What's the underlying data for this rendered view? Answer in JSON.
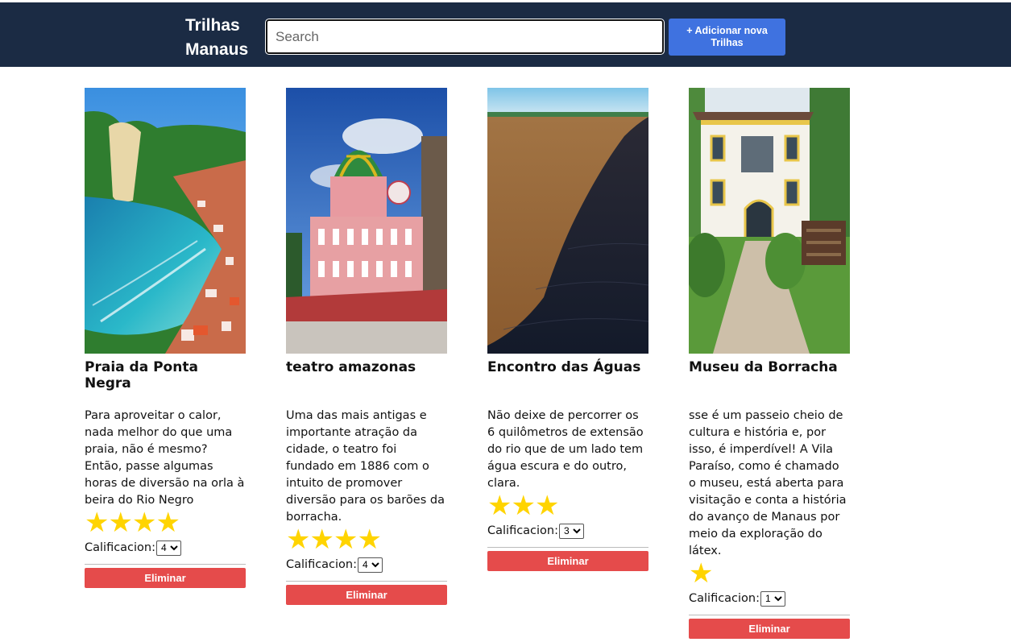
{
  "header": {
    "brand": "Trilhas Manaus",
    "search_placeholder": "Search",
    "add_button": "+ Adicionar nova Trilhas"
  },
  "colors": {
    "header_bg": "#1b2b44",
    "add_button": "#3f72e0",
    "delete_button": "#e54b4b",
    "star": "#ffd400"
  },
  "cards": [
    {
      "image": "beach-photo",
      "title": "Praia da Ponta Negra",
      "description": "Para aproveitar o calor, nada melhor do que uma praia, não é mesmo? Então, passe algumas horas de diversão na orla à beira do Rio Negro",
      "stars": "★★★★",
      "rating": 4,
      "rating_label": "Calificacion:",
      "rating_value": "4",
      "delete_label": "Eliminar"
    },
    {
      "image": "theater-photo",
      "title": "teatro amazonas",
      "description": "Uma das mais antigas e importante atração da cidade, o teatro foi fundado em 1886 com o intuito de promover diversão para os barões da borracha.",
      "stars": "★★★★",
      "rating": 4,
      "rating_label": "Calificacion:",
      "rating_value": "4",
      "delete_label": "Eliminar"
    },
    {
      "image": "river-meeting-photo",
      "title": "Encontro das Águas",
      "description": "Não deixe de percorrer os 6 quilômetros de extensão do rio que de um lado tem água escura e do outro, clara.",
      "stars": "★★★",
      "rating": 3,
      "rating_label": "Calificacion:",
      "rating_value": "3",
      "delete_label": "Eliminar"
    },
    {
      "image": "museum-photo",
      "title": "Museu da Borracha",
      "description": "sse é um passeio cheio de cultura e história e, por isso, é imperdível! A Vila Paraíso, como é chamado o museu, está aberta para visitação e conta a história do avanço de Manaus por meio da exploração do látex.",
      "stars": "★",
      "rating": 1,
      "rating_label": "Calificacion:",
      "rating_value": "1",
      "delete_label": "Eliminar"
    }
  ]
}
